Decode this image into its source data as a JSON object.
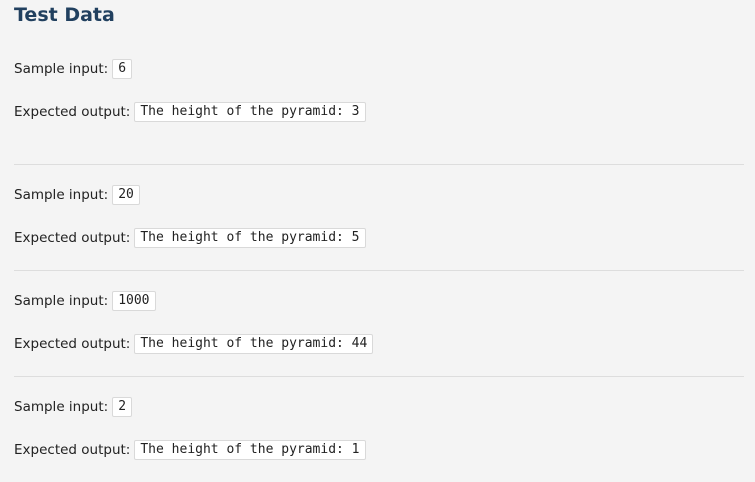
{
  "heading": "Test Data",
  "cases": [
    {
      "input_label": "Sample input:",
      "input_value": "6",
      "output_label": "Expected output:",
      "output_value": "The height of the pyramid: 3"
    },
    {
      "input_label": "Sample input:",
      "input_value": "20",
      "output_label": "Expected output:",
      "output_value": "The height of the pyramid: 5"
    },
    {
      "input_label": "Sample input:",
      "input_value": "1000",
      "output_label": "Expected output:",
      "output_value": "The height of the pyramid: 44"
    },
    {
      "input_label": "Sample input:",
      "input_value": "2",
      "output_label": "Expected output:",
      "output_value": "The height of the pyramid: 1"
    }
  ]
}
